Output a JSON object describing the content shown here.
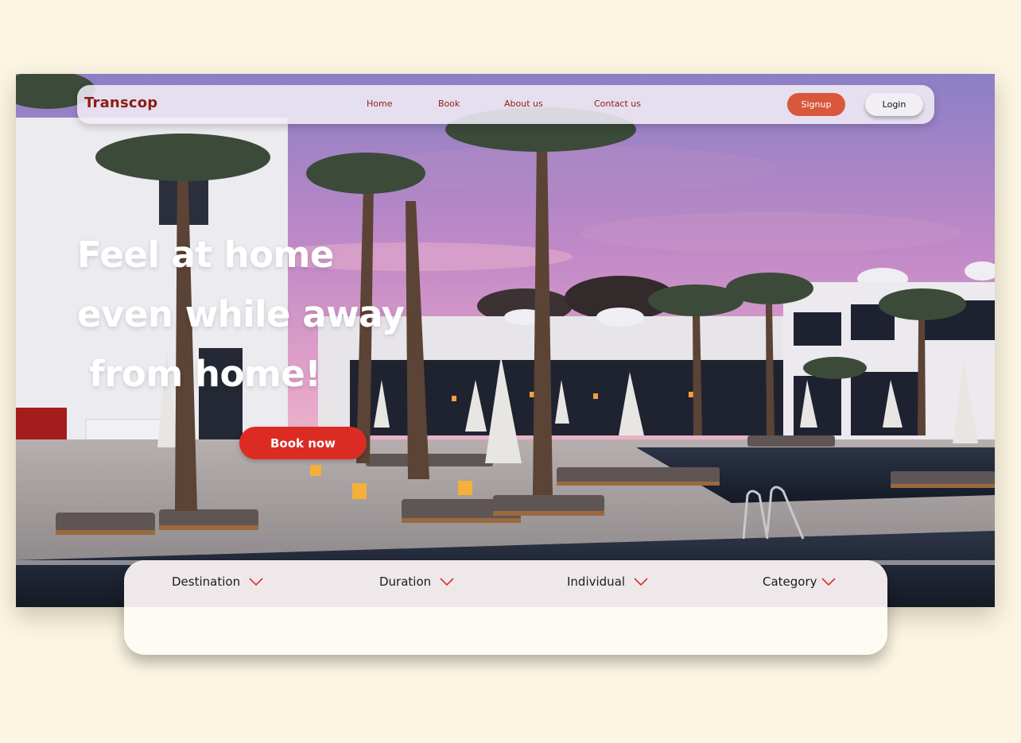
{
  "brand": "Transcop",
  "nav": {
    "links": [
      "Home",
      "Book",
      "About us",
      "Contact us"
    ],
    "signup_label": "Signup",
    "login_label": "Login"
  },
  "hero": {
    "headline_lines": [
      "Feel at home",
      "even while away",
      " from home!"
    ],
    "cta_label": "Book now"
  },
  "filters": [
    "Destination",
    "Duration",
    "Individual",
    "Category"
  ],
  "colors": {
    "brand": "#8f1c12",
    "signup": "#d9573b",
    "cta": "#dc2b23",
    "chevron": "#e0302a",
    "page_bg": "#fbf5e2"
  },
  "icons": {
    "filter_dropdown": "chevron-down-icon"
  }
}
